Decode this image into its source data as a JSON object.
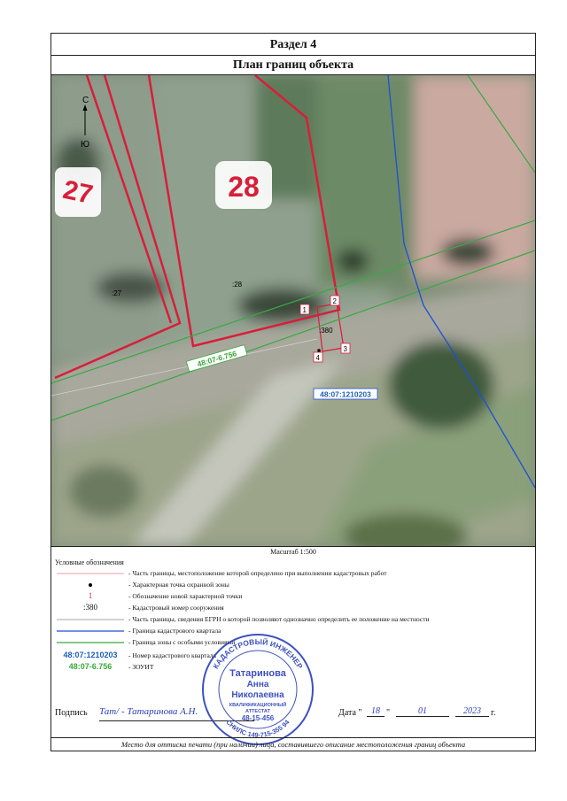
{
  "section_title": "Раздел 4",
  "plan_title": "План границ объекта",
  "map": {
    "north": "С",
    "south": "Ю",
    "parcel_27_number": "27",
    "parcel_28_number": "28",
    "label_27": ":27",
    "label_28": ":28",
    "label_380": ":380",
    "zone_label": "48:07-6.756",
    "quarter_label": "48:07:1210203",
    "points": [
      "1",
      "2",
      "3",
      "4"
    ]
  },
  "scale": "Масштаб 1:500",
  "legend": {
    "title": "Условные обозначения",
    "items": [
      {
        "symbol": "",
        "text": "- Часть границы, местоположение которой определено при выполнении кадастровых работ"
      },
      {
        "symbol": "",
        "text": "- Характерная точка охранной зоны"
      },
      {
        "symbol": "1",
        "text": "- Обозначение новой характерной точки"
      },
      {
        "symbol": ":380",
        "text": "- Кадастровый номер сооружения"
      },
      {
        "symbol": "",
        "text": "- Часть границы, сведения ЕГРН о которой позволяют однозначно определить ее положение на местности"
      },
      {
        "symbol": "",
        "text": "- Граница кадастрового квартала"
      },
      {
        "symbol": "",
        "text": "- Граница зоны с особыми условиями"
      },
      {
        "symbol": "48:07:1210203",
        "text": "- Номер кадастрового квартала"
      },
      {
        "symbol": "48:07-6.756",
        "text": "- ЗОУИТ"
      }
    ]
  },
  "signature": {
    "label": "Подпись",
    "handwriting": "Тат/ - Татаринова А.Н.",
    "date_label": "Дата \"",
    "day": "18",
    "month": "01",
    "year": "2023",
    "year_suffix": "г."
  },
  "stamp": {
    "top_arc": "КАДАСТРОВЫЙ ИНЖЕНЕР",
    "name_line1": "Татаринова",
    "name_line2": "Анна",
    "name_line3": "Николаевна",
    "cert_line1": "КВАЛИФИКАЦИОННЫЙ",
    "cert_line2": "АТТЕСТАТ",
    "cert_number": "48-15-456",
    "snils": "СНИЛС 149-715-355 94"
  },
  "footer": "Место для оттиска печати (при наличии) лица, составившего описание местоположения границ объекта",
  "colors": {
    "red_boundary": "#d81e3a",
    "green_zone": "#39a845",
    "blue_quarter": "#1e4fd8",
    "legend_pink": "#e8a0a8",
    "legend_gray": "#888888",
    "stamp_blue": "#2a3fb8",
    "quarter_text": "#1e5fb8",
    "zone_text": "#3aa83a"
  },
  "icons": [
    "north-arrow-icon"
  ]
}
